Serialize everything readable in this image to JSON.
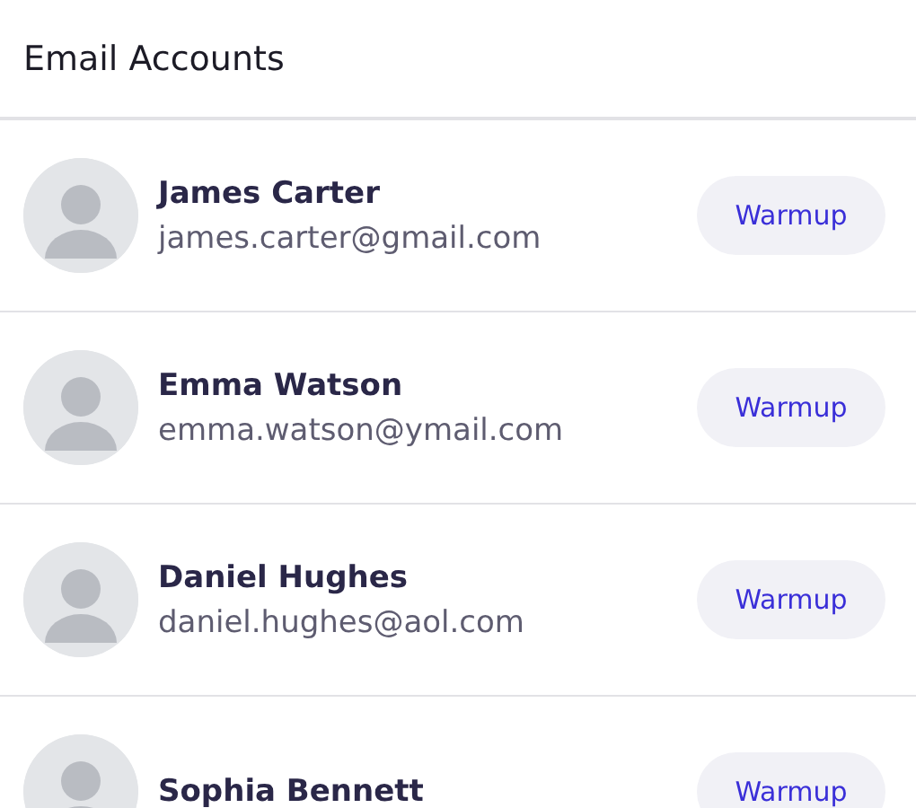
{
  "header": {
    "title": "Email Accounts"
  },
  "accounts": [
    {
      "name": "James Carter",
      "email": "james.carter@gmail.com",
      "action": "Warmup"
    },
    {
      "name": "Emma Watson",
      "email": "emma.watson@ymail.com",
      "action": "Warmup"
    },
    {
      "name": "Daniel Hughes",
      "email": "daniel.hughes@aol.com",
      "action": "Warmup"
    },
    {
      "name": "Sophia Bennett",
      "action": "Warmup"
    }
  ]
}
